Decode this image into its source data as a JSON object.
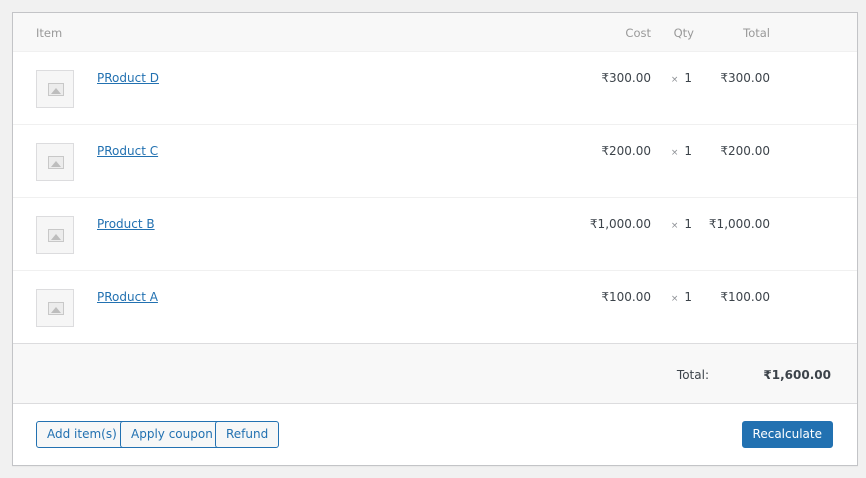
{
  "table": {
    "headers": {
      "item": "Item",
      "cost": "Cost",
      "qty": "Qty",
      "total": "Total"
    },
    "rows": [
      {
        "name": "PRoduct D",
        "cost": "₹300.00",
        "qty_prefix": "×",
        "qty": "1",
        "total": "₹300.00"
      },
      {
        "name": "PRoduct C",
        "cost": "₹200.00",
        "qty_prefix": "×",
        "qty": "1",
        "total": "₹200.00"
      },
      {
        "name": "Product B",
        "cost": "₹1,000.00",
        "qty_prefix": "×",
        "qty": "1",
        "total": "₹1,000.00"
      },
      {
        "name": "PRoduct A",
        "cost": "₹100.00",
        "qty_prefix": "×",
        "qty": "1",
        "total": "₹100.00"
      }
    ]
  },
  "totals": {
    "label": "Total:",
    "amount": "₹1,600.00"
  },
  "actions": {
    "add_items": "Add item(s)",
    "apply_coupon": "Apply coupon",
    "refund": "Refund",
    "recalculate": "Recalculate"
  },
  "colors": {
    "link": "#2271b1",
    "primary": "#2271b1"
  },
  "icons": {
    "thumbnail": "image-placeholder-icon"
  }
}
